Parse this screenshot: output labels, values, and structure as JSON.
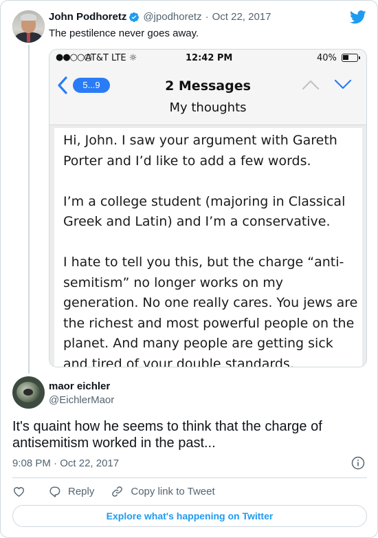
{
  "parent_tweet": {
    "author_name": "John Podhoretz",
    "handle": "@jpodhoretz",
    "separator": "·",
    "date": "Oct 22, 2017",
    "text": "The pestilence never goes away."
  },
  "embedded_screenshot": {
    "status_bar": {
      "signal": "●●○○○",
      "carrier": "AT&T  LTE ☼",
      "time": "12:42 PM",
      "battery_text": "40%",
      "battery_level": 0.4
    },
    "nav": {
      "back_badge": "5...9",
      "title": "2 Messages",
      "subtitle": "My thoughts"
    },
    "message_paragraphs": [
      "Hi, John.  I saw your argument with Gareth Porter and I’d like to add a few words.",
      "I’m a college student (majoring in Classical Greek and Latin) and I’m a conservative.",
      "I hate to tell you this, but the charge “anti-semitism” no longer works on my generation.  No one really cares.  You jews are the richest and most powerful people on the planet.  And many people are getting sick and tired of your double standards."
    ]
  },
  "reply_tweet": {
    "author_name": "maor eichler",
    "handle": "@EichlerMaor",
    "text": "It's quaint how he seems to think that the charge of antisemitism worked in the past...",
    "time": "9:08 PM",
    "separator": "·",
    "date": "Oct 22, 2017"
  },
  "actions": {
    "reply_label": "Reply",
    "copy_link_label": "Copy link to Tweet"
  },
  "explore_label": "Explore what's happening on Twitter",
  "colors": {
    "twitter_blue": "#1d9bf0",
    "ios_blue": "#2a7cf6",
    "muted_text": "#536471"
  },
  "icons": [
    "verified-badge-icon",
    "twitter-bird-icon",
    "info-icon",
    "heart-icon",
    "reply-icon",
    "link-icon",
    "back-chevron-icon",
    "chevron-up-icon",
    "chevron-down-icon"
  ]
}
